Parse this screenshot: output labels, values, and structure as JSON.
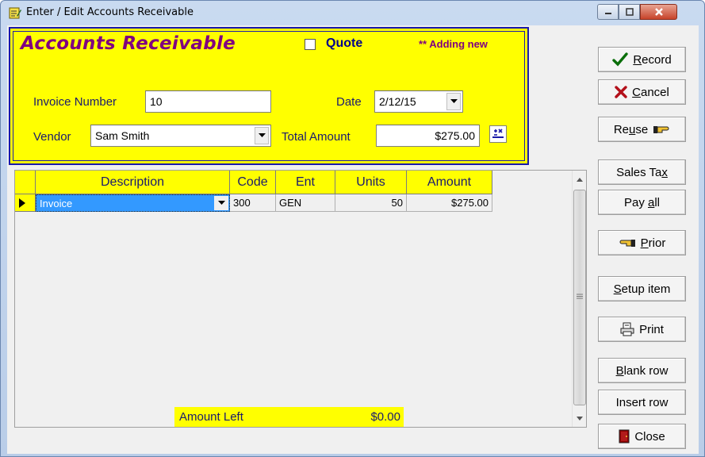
{
  "window": {
    "title": "Enter / Edit Accounts Receivable"
  },
  "header": {
    "title": "Accounts Receivable",
    "quote_label": "Quote",
    "quote_checked": false,
    "status": "** Adding new",
    "invoice_label": "Invoice Number",
    "invoice_value": "10",
    "date_label": "Date",
    "date_value": "2/12/15",
    "vendor_label": "Vendor",
    "vendor_value": "Sam Smith",
    "total_label": "Total Amount",
    "total_value": "$275.00"
  },
  "grid": {
    "columns": [
      "Description",
      "Code",
      "Ent",
      "Units",
      "Amount"
    ],
    "rows": [
      {
        "description": "Invoice",
        "code": "300",
        "ent": "GEN",
        "units": "50",
        "amount": "$275.00"
      }
    ]
  },
  "footer": {
    "amount_left_label": "Amount Left",
    "amount_left_value": "$0.00"
  },
  "buttons": {
    "record": {
      "pre": "",
      "key": "R",
      "post": "ecord"
    },
    "cancel": {
      "pre": "",
      "key": "C",
      "post": "ancel"
    },
    "reuse": {
      "pre": "Re",
      "key": "u",
      "post": "se"
    },
    "sales_tax": {
      "pre": "Sales Ta",
      "key": "x",
      "post": ""
    },
    "pay_all": {
      "pre": "Pay ",
      "key": "a",
      "post": "ll"
    },
    "prior": {
      "pre": "",
      "key": "P",
      "post": "rior"
    },
    "setup_item": {
      "pre": "",
      "key": "S",
      "post": "etup item"
    },
    "print": {
      "pre": "",
      "key": "",
      "post": "Print"
    },
    "blank_row": {
      "pre": "",
      "key": "B",
      "post": "lank row"
    },
    "insert_row": {
      "pre": "",
      "key": "",
      "post": "Insert row"
    },
    "close": {
      "pre": "",
      "key": "",
      "post": "Close"
    }
  },
  "colors": {
    "header_bg": "#ffff00",
    "header_border": "#1a1aa8",
    "title_color": "#800080",
    "selection": "#3399ff"
  }
}
